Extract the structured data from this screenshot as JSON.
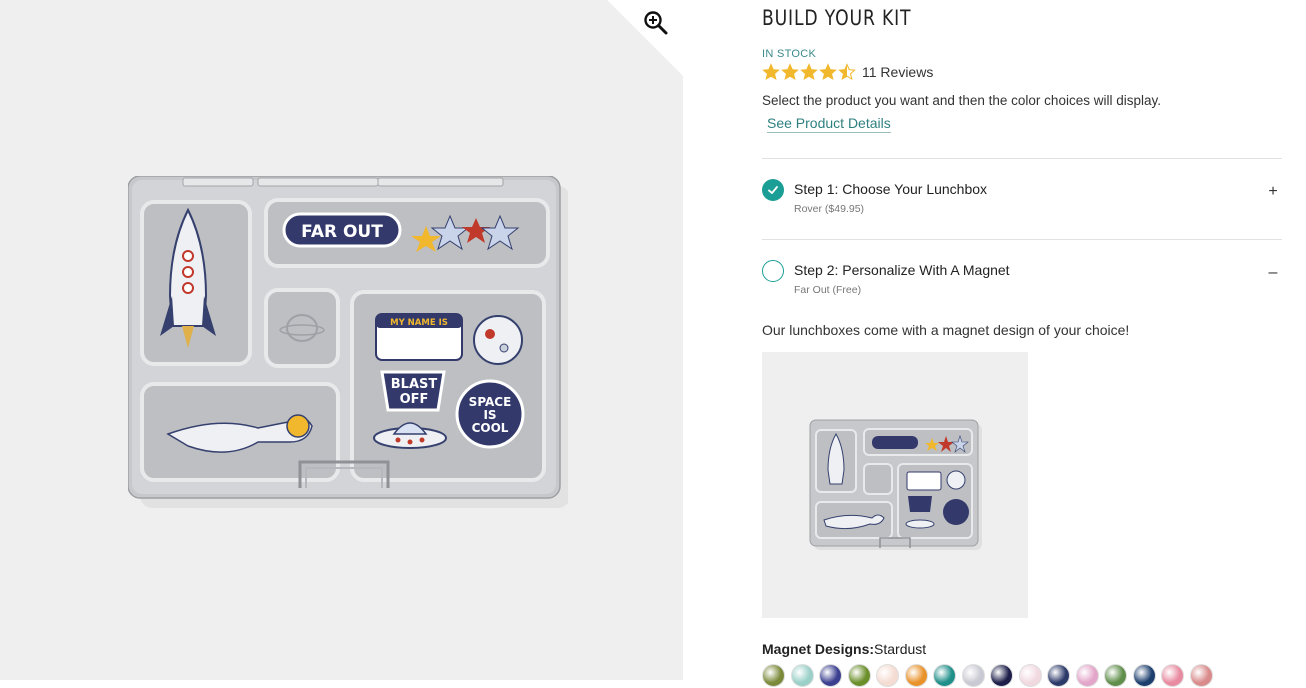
{
  "product": {
    "title": "BUILD YOUR KIT",
    "stock": "IN STOCK",
    "rating": 4.5,
    "reviews": "11 Reviews",
    "instructions": "Select the product you want and then the color choices will display.",
    "details_link": "See Product Details"
  },
  "steps": [
    {
      "label": "Step 1: Choose Your Lunchbox",
      "sub": "Rover ($49.95)",
      "toggle": "+",
      "completed": true
    },
    {
      "label": "Step 2: Personalize With A Magnet",
      "sub": "Far Out (Free)",
      "toggle": "–",
      "completed": false
    }
  ],
  "magnet": {
    "description": "Our lunchboxes come with a magnet design of your choice!",
    "designs_label": "Magnet Designs:",
    "selected_design": "Stardust"
  },
  "stickers": {
    "far_out": "FAR OUT",
    "my_name_is": "MY NAME IS",
    "blast": "BLAST",
    "off": "OFF",
    "space": "SPACE",
    "is": "IS",
    "cool": "COOL"
  },
  "colors": {
    "accent": "#1b9e95",
    "star": "#f1b82d",
    "link": "#2f7f7f",
    "sticker_navy": "#33396b"
  },
  "swatch_colors": [
    "#7b8a3a",
    "#9ad0c8",
    "#3b3f8f",
    "#6b8f2a",
    "#f4dcd2",
    "#e9922a",
    "#1f8f8a",
    "#c9c9d3",
    "#1d1f4a",
    "#f1d9e0",
    "#2c3a6a",
    "#e3a5c9",
    "#5f8f4a",
    "#1c3f6e",
    "#e88aa0",
    "#d98a8a"
  ],
  "icons": {
    "zoom": "zoom-in-icon",
    "check": "check-icon",
    "star": "star-icon"
  }
}
